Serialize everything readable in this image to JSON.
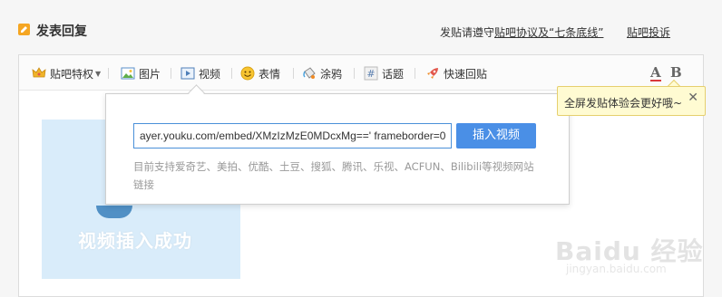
{
  "header": {
    "title": "发表回复",
    "notice_prefix": "发贴请遵守",
    "notice_link": "贴吧协议及“七条底线”",
    "complaint": "贴吧投诉"
  },
  "toolbar": {
    "privilege": "贴吧特权",
    "image": "图片",
    "video": "视频",
    "emoji": "表情",
    "doodle": "涂鸦",
    "topic": "话题",
    "quick_reply": "快速回贴",
    "font_a": "A",
    "font_b": "B"
  },
  "popup": {
    "url_value": "ayer.youku.com/embed/XMzIzMzE0MDcxMg==' frameborder=0",
    "insert_button": "插入视频",
    "support_text": "目前支持爱奇艺、美拍、优酷、土豆、搜狐、腾讯、乐视、ACFUN、Bilibili等视频网站链接"
  },
  "tooltip": {
    "text": "全屏发贴体验会更好哦~",
    "close": "✕"
  },
  "content": {
    "success_text": "视频插入成功"
  },
  "watermark": {
    "main": "Baidu 经验",
    "sub": "jingyan.baidu.com"
  },
  "colors": {
    "accent_blue": "#4a8fe6",
    "title_icon": "#f5a623",
    "tooltip_bg": "#fffbd2"
  }
}
